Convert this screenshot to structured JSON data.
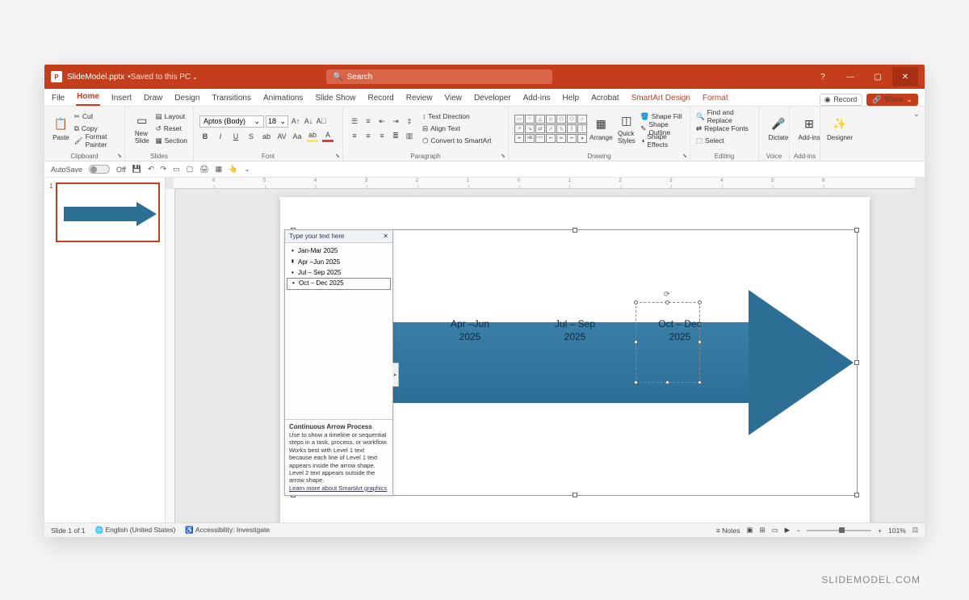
{
  "titlebar": {
    "doc": "SlideModel.pptx",
    "saved": "Saved to this PC",
    "search_ph": "Search"
  },
  "tabs": [
    "File",
    "Home",
    "Insert",
    "Draw",
    "Design",
    "Transitions",
    "Animations",
    "Slide Show",
    "Record",
    "Review",
    "View",
    "Developer",
    "Add-ins",
    "Help",
    "Acrobat",
    "SmartArt Design",
    "Format"
  ],
  "tab_right": {
    "record": "Record",
    "share": "Share"
  },
  "ribbon": {
    "clipboard": {
      "label": "Clipboard",
      "paste": "Paste",
      "cut": "Cut",
      "copy": "Copy",
      "fp": "Format Painter"
    },
    "slides": {
      "label": "Slides",
      "new": "New\nSlide",
      "layout": "Layout",
      "reset": "Reset",
      "section": "Section"
    },
    "font": {
      "label": "Font",
      "name": "Aptos (Body)",
      "size": "18"
    },
    "paragraph": {
      "label": "Paragraph",
      "td": "Text Direction",
      "at": "Align Text",
      "cs": "Convert to SmartArt"
    },
    "drawing": {
      "label": "Drawing",
      "arrange": "Arrange",
      "qs": "Quick\nStyles",
      "fill": "Shape Fill",
      "outline": "Shape Outline",
      "effects": "Shape Effects"
    },
    "editing": {
      "label": "Editing",
      "find": "Find and Replace",
      "replace": "Replace Fonts",
      "select": "Select"
    },
    "voice": {
      "label": "Voice",
      "dictate": "Dictate"
    },
    "addins": {
      "label": "Add-ins",
      "btn": "Add-ins"
    },
    "designer": {
      "label": "",
      "btn": "Designer"
    }
  },
  "qat": {
    "autosave": "AutoSave",
    "off": "Off"
  },
  "thumb": {
    "n": "1"
  },
  "textpane": {
    "title": "Type your text here",
    "items": [
      "Jan-Mar 2025",
      "",
      "Apr –Jun 2025",
      "Jul – Sep 2025",
      "Oct – Dec 2025"
    ],
    "desc_title": "Continuous Arrow Process",
    "desc": "Use to show a timeline or sequential steps in a task, process, or workflow. Works best with Level 1 text because each line of Level 1 text appears inside the arrow shape. Level 2 text appears outside the arrow shape.",
    "link": "Learn more about SmartArt graphics"
  },
  "arrow": {
    "q1": "Jan-Mar\n2025",
    "q2": "Apr –Jun\n2025",
    "q3": "Jul – Sep\n2025",
    "q4": "Oct – Dec\n2025"
  },
  "status": {
    "slide": "Slide 1 of 1",
    "lang": "English (United States)",
    "acc": "Accessibility: Investigate",
    "notes": "Notes",
    "zoom": "101%"
  },
  "watermark": "SLIDEMODEL.COM",
  "ruler": [
    "6",
    "5",
    "4",
    "3",
    "2",
    "1",
    "0",
    "1",
    "2",
    "3",
    "4",
    "5",
    "6"
  ]
}
